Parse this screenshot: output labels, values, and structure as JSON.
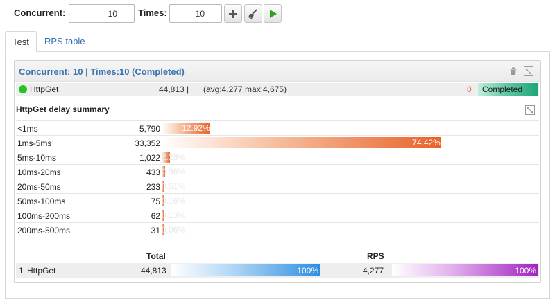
{
  "toolbar": {
    "concurrent_label": "Concurrent:",
    "concurrent_value": "10",
    "times_label": "Times:",
    "times_value": "10"
  },
  "tabs": [
    {
      "label": "Test",
      "active": true
    },
    {
      "label": "RPS table",
      "active": false
    }
  ],
  "panel": {
    "title": "Concurrent: 10 | Times:10 (Completed)",
    "request": {
      "name": "HttpGet",
      "total": "44,813 |",
      "stats": "(avg:4,277 max:4,675)",
      "errors": "0",
      "status": "Completed"
    }
  },
  "summary": {
    "title": "HttpGet delay summary",
    "rows": [
      {
        "label": "<1ms",
        "count": "5,790",
        "percent": "12.92%",
        "fraction": 0.1292
      },
      {
        "label": "1ms-5ms",
        "count": "33,352",
        "percent": "74.42%",
        "fraction": 0.7442
      },
      {
        "label": "5ms-10ms",
        "count": "1,022",
        "percent": "2.28%",
        "fraction": 0.0228
      },
      {
        "label": "10ms-20ms",
        "count": "433",
        "percent": "0.96%",
        "fraction": 0.0096
      },
      {
        "label": "20ms-50ms",
        "count": "233",
        "percent": "0.51%",
        "fraction": 0.0051
      },
      {
        "label": "50ms-100ms",
        "count": "75",
        "percent": "0.16%",
        "fraction": 0.0016
      },
      {
        "label": "100ms-200ms",
        "count": "62",
        "percent": "0.13%",
        "fraction": 0.0013
      },
      {
        "label": "200ms-500ms",
        "count": "31",
        "percent": "0.06%",
        "fraction": 0.0006
      }
    ]
  },
  "totals": {
    "total_header": "Total",
    "rps_header": "RPS",
    "row": {
      "index": "1",
      "name": "HttpGet",
      "total": "44,813",
      "total_percent": "100%",
      "total_fraction": 1.0,
      "rps": "4,277",
      "rps_percent": "100%",
      "rps_fraction": 1.0
    }
  },
  "icons": [
    "plus-icon",
    "broom-icon",
    "play-icon",
    "trash-icon",
    "expand-icon"
  ],
  "colors": {
    "accent_blue": "#3a74b0",
    "link_blue": "#2f6fb8",
    "delay_bar": "#e8622a",
    "total_bar": "#2e8fe0",
    "rps_bar": "#a224c0",
    "status_green": "#1ea579",
    "running_dot": "#25c521",
    "error_orange": "#e0702a"
  }
}
